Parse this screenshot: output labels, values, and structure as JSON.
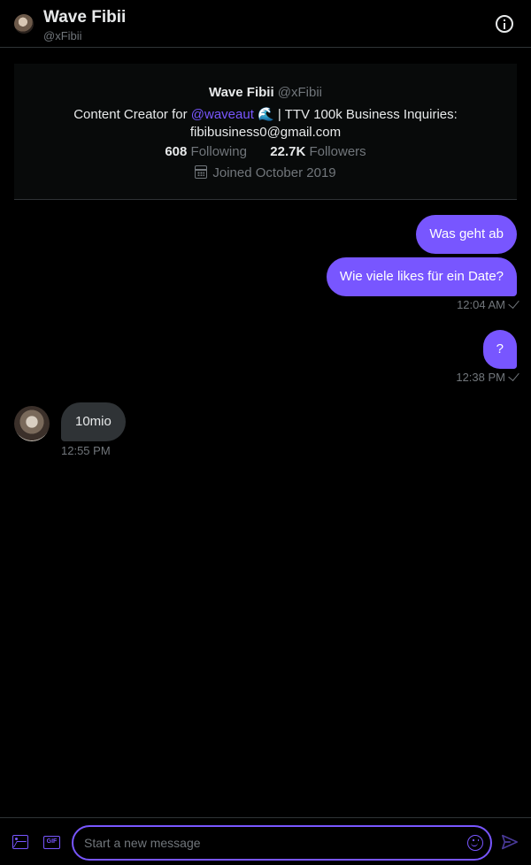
{
  "header": {
    "name": "Wave Fibii",
    "handle": "@xFibii",
    "avatar_icon": "user-avatar",
    "info_icon": "info-icon"
  },
  "profile": {
    "name": "Wave Fibii",
    "handle": "@xFibii",
    "bio_prefix": "Content Creator for ",
    "bio_mention": "@waveaut",
    "bio_emoji": "🌊",
    "bio_suffix": " | TTV 100k  Business Inquiries:",
    "bio_email": "fibibusiness0@gmail.com",
    "following_count": "608",
    "following_label": "Following",
    "followers_count": "22.7K",
    "followers_label": "Followers",
    "joined": "Joined October 2019"
  },
  "messages": {
    "outgoing": [
      {
        "text": "Was geht ab"
      },
      {
        "text": "Wie viele likes für ein Date?",
        "time": "12:04 AM"
      },
      {
        "text": "?",
        "time": "12:38 PM"
      }
    ],
    "incoming": [
      {
        "text": "10mio",
        "time": "12:55 PM"
      }
    ]
  },
  "composer": {
    "placeholder": "Start a new message",
    "gif_label": "GIF"
  },
  "colors": {
    "accent": "#7856ff",
    "background": "#000000",
    "incoming_bubble": "#2f3336",
    "muted": "#71767b"
  }
}
